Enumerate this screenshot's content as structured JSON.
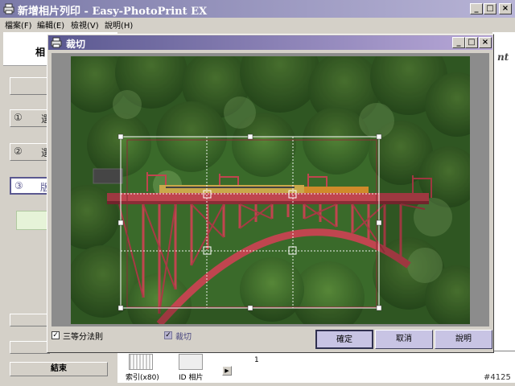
{
  "main_window": {
    "title": "新增相片列印 - Easy-PhotoPrint EX",
    "caption_buttons": [
      "_",
      "□",
      "×"
    ]
  },
  "menu": {
    "items": [
      "檔案(F)",
      "編輯(E)",
      "檢視(V)",
      "說明(H)"
    ]
  },
  "left_panel": {
    "header_text": "相",
    "steps": [
      "①",
      "②",
      "③"
    ],
    "step_trailing": [
      "選",
      "選",
      "版"
    ],
    "end_button_label": "結束"
  },
  "right_edge_text": "nt",
  "dialog": {
    "title": "裁切",
    "caption_buttons": [
      "_",
      "□",
      "×"
    ],
    "checkbox_thirds_label": "三等分法則",
    "checkbox_thirds_mark": "✓",
    "checkbox_crop_label": "裁切",
    "checkbox_crop_mark": "✓",
    "ok_label": "確定",
    "cancel_label": "取消",
    "help_label": "說明"
  },
  "bottom_strip": {
    "thumb1_label": "索引(x80)",
    "thumb2_label": "ID 相片",
    "page_number": "1"
  },
  "watermark": "#4125",
  "colors": {
    "title_start": "#7b7aa8",
    "dialog_title_start": "#5a5890",
    "button_fill": "#c8c4e4",
    "bridge": "#c0454f",
    "train": "#d08a2a"
  }
}
